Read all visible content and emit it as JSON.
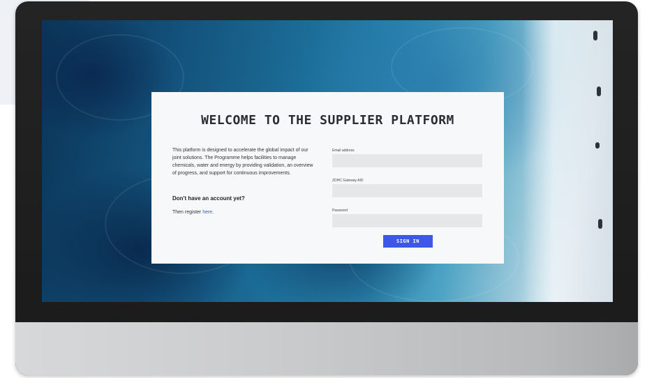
{
  "login": {
    "title": "WELCOME TO THE SUPPLIER PLATFORM",
    "intro": "This platform is designed to accelerate the global impact of our joint solutions. The Programme helps facilities to manage chemicals, water and energy by providing validation, an overview of progress, and support for continuous improvements.",
    "no_account": "Don't have an account yet?",
    "register_prefix": "Then register ",
    "register_link": "here",
    "register_suffix": ".",
    "email_label": "Email address",
    "zdhc_label": "ZDHC Gateway AID",
    "password_label": "Password",
    "email_value": "",
    "zdhc_value": "",
    "password_value": "",
    "signin_label": "SIGN IN"
  },
  "colors": {
    "accent": "#3e57e6",
    "link": "#3b57d6",
    "card": "#f7f8f9",
    "input": "#e6e7e8",
    "bezel": "#1e1e1e"
  }
}
